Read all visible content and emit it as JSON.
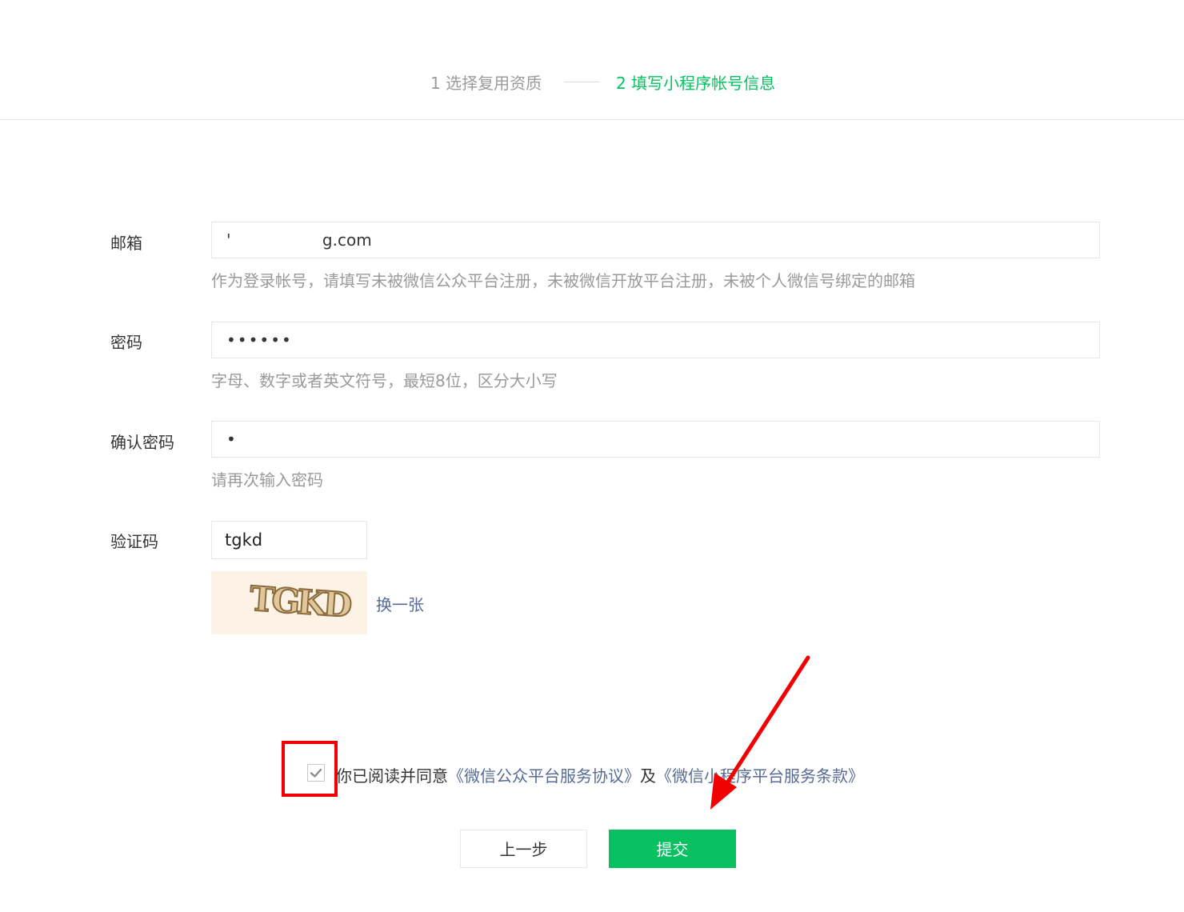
{
  "steps": {
    "step1": "1 选择复用资质",
    "step2": "2 填写小程序帐号信息",
    "active_color": "#07c160",
    "inactive_color": "#9a9a9a"
  },
  "form": {
    "email": {
      "label": "邮箱",
      "value": "'                  g.com",
      "hint": "作为登录帐号，请填写未被微信公众平台注册，未被微信开放平台注册，未被个人微信号绑定的邮箱"
    },
    "password": {
      "label": "密码",
      "value": "••••••",
      "hint": "字母、数字或者英文符号，最短8位，区分大小写"
    },
    "confirm_password": {
      "label": "确认密码",
      "value": "•",
      "hint": "请再次输入密码"
    },
    "captcha": {
      "label": "验证码",
      "value": "tgkd",
      "image_text": "TGKD",
      "refresh_label": "换一张"
    }
  },
  "agreement": {
    "checked": true,
    "prefix": "你已阅读并同意",
    "link1": "《微信公众平台服务协议》",
    "middle": "及",
    "link2": "《微信小程序平台服务条款》"
  },
  "buttons": {
    "prev": "上一步",
    "submit": "提交"
  },
  "annotations": {
    "highlight_color": "#f20000"
  },
  "icons": {
    "checkbox": "check-icon",
    "arrow": "red-arrow-icon"
  }
}
